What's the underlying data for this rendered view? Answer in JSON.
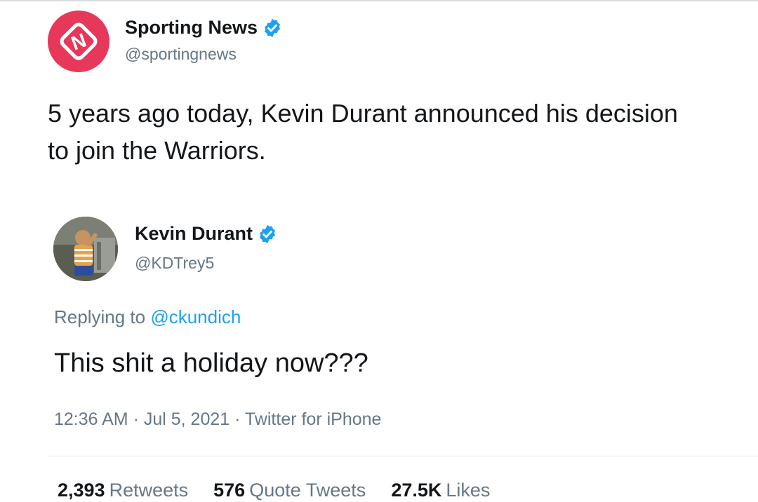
{
  "original_tweet": {
    "display_name": "Sporting News",
    "handle": "@sportingnews",
    "verified_icon": "verified-badge-icon",
    "avatar_icon": "sporting-news-logo-icon",
    "text": "5 years ago today, Kevin Durant announced his decision to join the Warriors."
  },
  "reply_tweet": {
    "display_name": "Kevin Durant",
    "handle": "@KDTrey5",
    "verified_icon": "verified-badge-icon",
    "replying_prefix": "Replying to",
    "replying_to": "@ckundich",
    "text": "This shit a holiday now???",
    "meta": "12:36 AM · Jul 5, 2021 · Twitter for iPhone",
    "stats": {
      "retweets_count": "2,393",
      "retweets_label": "Retweets",
      "quote_count": "576",
      "quote_label": "Quote Tweets",
      "likes_count": "27.5K",
      "likes_label": "Likes"
    }
  },
  "colors": {
    "sporting_news_brand": "#e7385a",
    "verified_blue": "#1da1f2",
    "secondary_text": "#657786",
    "primary_text": "#14171a"
  }
}
